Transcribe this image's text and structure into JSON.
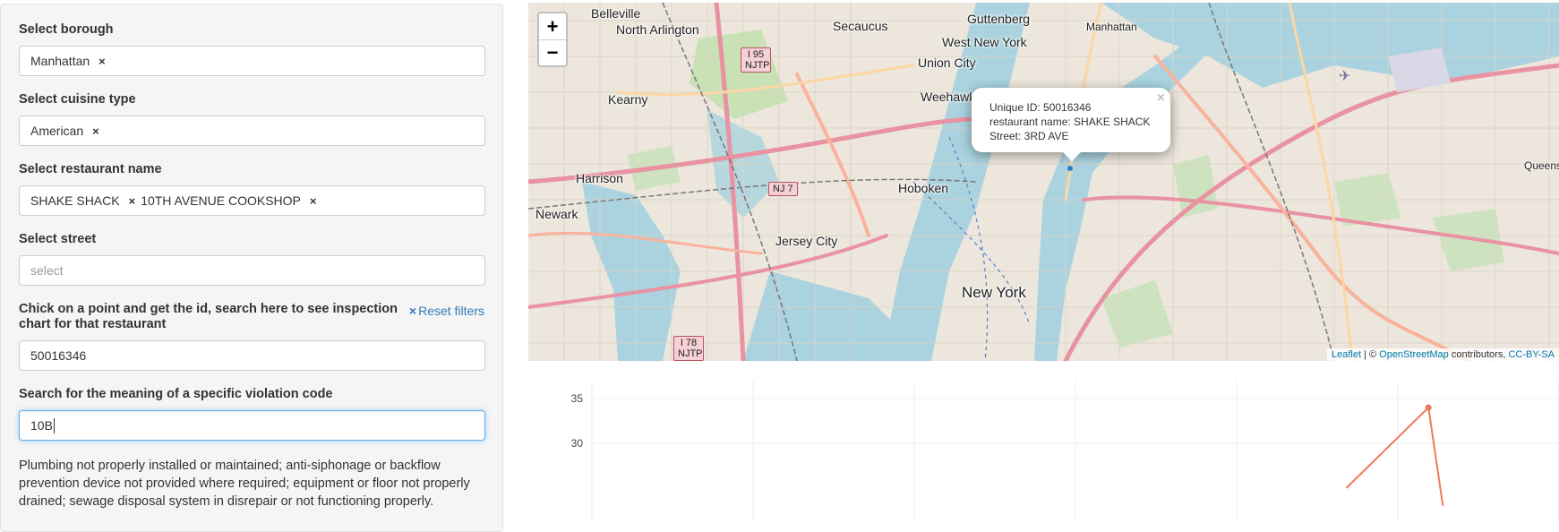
{
  "sidebar": {
    "borough": {
      "label": "Select borough",
      "tags": [
        "Manhattan"
      ]
    },
    "cuisine": {
      "label": "Select cuisine type",
      "tags": [
        "American"
      ]
    },
    "restaurant": {
      "label": "Select restaurant name",
      "tags": [
        "SHAKE SHACK",
        "10TH AVENUE COOKSHOP"
      ]
    },
    "street": {
      "label": "Select street",
      "placeholder": "select"
    },
    "inspection": {
      "label": "Chick on a point and get the id, search here to see inspection chart for that restaurant",
      "value": "50016346",
      "reset_icon": "×",
      "reset_label": "Reset filters"
    },
    "violation": {
      "label": "Search for the meaning of a specific violation code",
      "value": "10B",
      "description": "Plumbing not properly installed or maintained; anti-siphonage or backflow prevention device not provided where required; equipment or floor not properly drained; sewage disposal system in disrepair or not functioning properly."
    },
    "remove_glyph": "×"
  },
  "map": {
    "zoom_in": "+",
    "zoom_out": "−",
    "popup": {
      "line1": "Unique ID: 50016346",
      "line2": "restaurant name: SHAKE SHACK",
      "line3": "Street: 3RD AVE",
      "close": "×"
    },
    "places": [
      "Belleville",
      "North Arlington",
      "Secaucus",
      "Guttenberg",
      "West New York",
      "Manhattan",
      "Union City",
      "Kearny",
      "Weehawken",
      "Harrison",
      "Hoboken",
      "Newark",
      "Jersey City",
      "New York",
      "Queens"
    ],
    "shields": [
      "I 95 NJTP",
      "NJ 7",
      "I 78 NJTP"
    ],
    "attribution": {
      "leaflet": "Leaflet",
      "sep": " | © ",
      "osm": "OpenStreetMap",
      "contrib": " contributors, ",
      "license": "CC-BY-SA"
    }
  },
  "chart_data": {
    "type": "line",
    "y_ticks": [
      30,
      35
    ],
    "series": [
      {
        "color": "#ef7b5a",
        "points": [
          [
            0.78,
            25
          ],
          [
            0.865,
            34
          ],
          [
            0.88,
            23
          ]
        ]
      }
    ],
    "gridlines_x": 6
  },
  "colors": {
    "accent": "#337ab7",
    "series": "#ef7b5a"
  }
}
